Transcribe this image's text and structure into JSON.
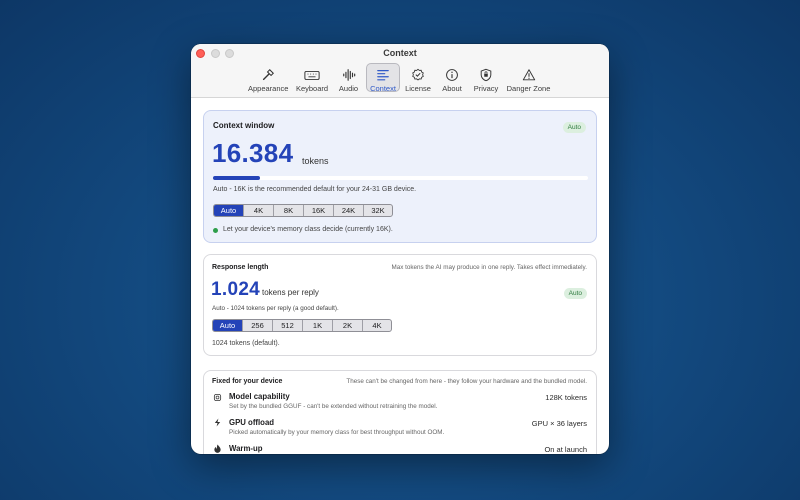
{
  "window": {
    "title": "Context"
  },
  "toolbar": {
    "items": [
      {
        "label": "Appearance",
        "icon": "hammer-icon"
      },
      {
        "label": "Keyboard",
        "icon": "keyboard-icon"
      },
      {
        "label": "Audio",
        "icon": "waveform-icon"
      },
      {
        "label": "Context",
        "icon": "text-lines-icon",
        "active": true
      },
      {
        "label": "License",
        "icon": "seal-check-icon"
      },
      {
        "label": "About",
        "icon": "info-icon"
      },
      {
        "label": "Privacy",
        "icon": "hand-shield-icon"
      },
      {
        "label": "Danger Zone",
        "icon": "warning-icon"
      }
    ]
  },
  "context_window": {
    "title": "Context window",
    "badge": "Auto",
    "value": "16.384",
    "unit": "tokens",
    "progress_fraction": 0.125,
    "recommendation": "Auto - 16K is the recommended default for your 24-31 GB device.",
    "options": [
      "Auto",
      "4K",
      "8K",
      "16K",
      "24K",
      "32K"
    ],
    "selected": "Auto",
    "status": "Let your device's memory class decide (currently 16K)."
  },
  "response_length": {
    "title": "Response length",
    "hint": "Max tokens the AI may produce in one reply. Takes effect immediately.",
    "badge": "Auto",
    "value": "1.024",
    "unit": "tokens per reply",
    "recommendation": "Auto - 1024 tokens per reply (a good default).",
    "options": [
      "Auto",
      "256",
      "512",
      "1K",
      "2K",
      "4K"
    ],
    "selected": "Auto",
    "status": "1024 tokens (default)."
  },
  "fixed": {
    "title": "Fixed for your device",
    "hint": "These can't be changed from here - they follow your hardware and the bundled model.",
    "rows": [
      {
        "label": "Model capability",
        "value": "128K tokens",
        "desc": "Set by the bundled GGUF - can't be extended without retraining the model.",
        "icon": "chip-icon"
      },
      {
        "label": "GPU offload",
        "value": "GPU × 36 layers",
        "desc": "Picked automatically by your memory class for best throughput without OOM.",
        "icon": "bolt-icon"
      },
      {
        "label": "Warm-up",
        "value": "On at launch",
        "desc": "",
        "icon": "flame-icon"
      }
    ]
  },
  "colors": {
    "accent": "#2443b8",
    "badge_green": "#2d7a3e",
    "status_dot": "#2e9e4a"
  }
}
